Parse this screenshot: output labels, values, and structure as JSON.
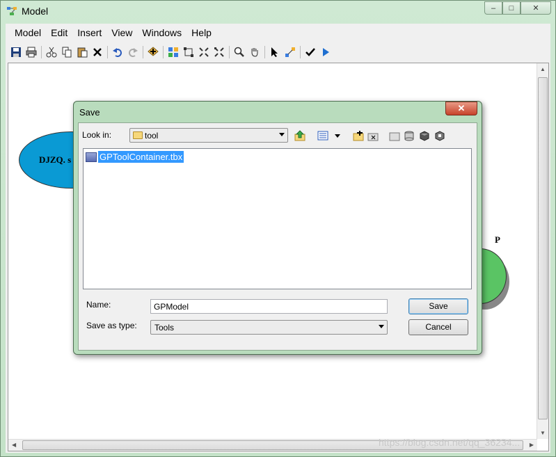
{
  "window": {
    "title": "Model",
    "minimize_icon": "minimize-icon",
    "maximize_icon": "maximize-icon",
    "close_icon": "close-icon",
    "minimize_glyph": "–",
    "maximize_glyph": "□",
    "close_glyph": "✕"
  },
  "menu": {
    "items": [
      "Model",
      "Edit",
      "Insert",
      "View",
      "Windows",
      "Help"
    ]
  },
  "toolbar": {
    "groups": [
      [
        "save-icon",
        "print-icon"
      ],
      [
        "cut-icon",
        "copy-icon",
        "paste-icon",
        "delete-icon"
      ],
      [
        "undo-icon",
        "redo-icon"
      ],
      [
        "add-data-icon"
      ],
      [
        "auto-layout-icon",
        "full-extent-icon",
        "zoom-in-fixed-icon",
        "zoom-out-fixed-icon"
      ],
      [
        "zoom-icon",
        "pan-icon"
      ],
      [
        "select-icon",
        "connect-icon"
      ],
      [
        "validate-icon",
        "run-icon"
      ]
    ]
  },
  "canvas": {
    "blue_element_label": "DJZQ. s",
    "green_element_label": "P",
    "green_element_text": "."
  },
  "watermark": "https://blog.csdn.net/qq_36234...",
  "dialog": {
    "title": "Save",
    "close_glyph": "✕",
    "look_in_label": "Look in:",
    "look_in_value": "tool",
    "files": [
      {
        "name": "GPToolContainer.tbx",
        "icon": "toolbox-icon",
        "selected": true
      }
    ],
    "name_label": "Name:",
    "name_value": "GPModel",
    "save_as_type_label": "Save as type:",
    "save_as_type_value": "Tools",
    "save_button": "Save",
    "cancel_button": "Cancel"
  }
}
